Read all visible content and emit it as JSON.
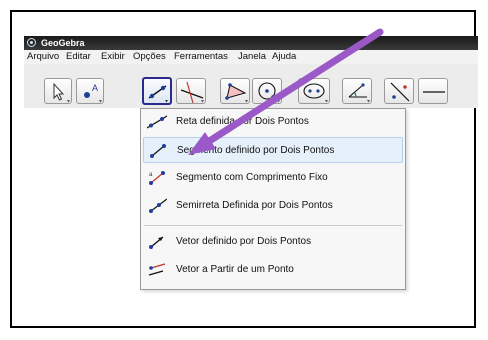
{
  "window": {
    "title": "GeoGebra"
  },
  "menubar": {
    "items": [
      "Arquivo",
      "Editar",
      "Exibir",
      "Opções",
      "Ferramentas",
      "Janela",
      "Ajuda"
    ]
  },
  "toolbar": {
    "tools": [
      {
        "icon": "move-arrow-icon"
      },
      {
        "icon": "new-point-icon"
      },
      {
        "icon": "line-through-two-points-icon"
      },
      {
        "icon": "perpendicular-line-icon"
      },
      {
        "icon": "polygon-icon"
      },
      {
        "icon": "circle-center-point-icon"
      },
      {
        "icon": "ellipse-icon"
      },
      {
        "icon": "angle-icon"
      },
      {
        "icon": "reflect-about-line-icon"
      }
    ]
  },
  "dropdown": {
    "items": [
      {
        "label": "Reta definida por Dois Pontos",
        "icon": "line-icon"
      },
      {
        "label": "Segmento definido por Dois Pontos",
        "icon": "segment-icon"
      },
      {
        "label": "Segmento com Comprimento Fixo",
        "icon": "fixed-segment-icon"
      },
      {
        "label": "Semirreta Definida por Dois Pontos",
        "icon": "ray-icon"
      },
      {
        "label": "Vetor definido por Dois Pontos",
        "icon": "vector-icon"
      },
      {
        "label": "Vetor a Partir de um Ponto",
        "icon": "vector-from-point-icon"
      }
    ]
  },
  "colors": {
    "annotation_arrow": "#9b59c8",
    "hover_bg": "#e6f0fa",
    "selected_border": "#2a2a8a"
  }
}
